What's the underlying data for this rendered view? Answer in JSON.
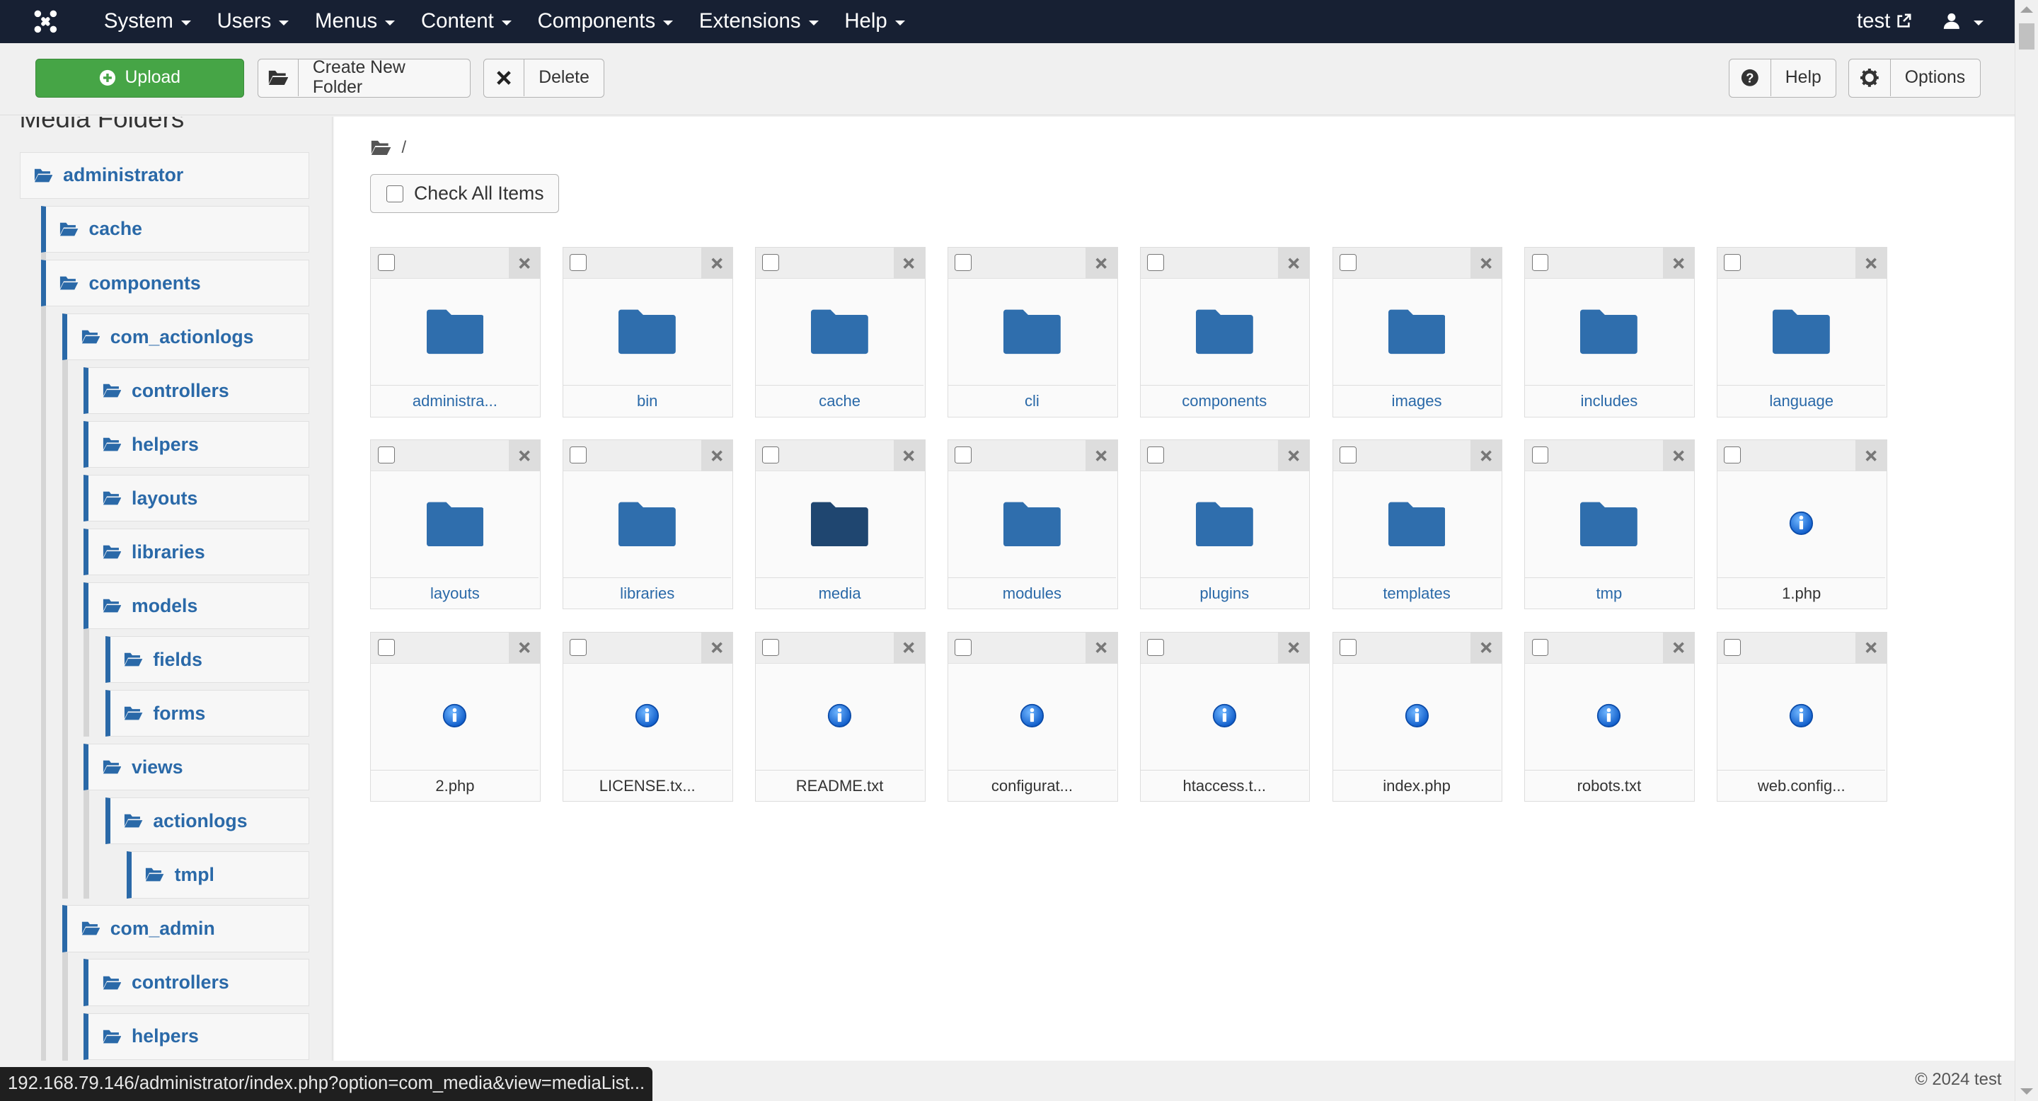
{
  "navbar": {
    "items": [
      "System",
      "Users",
      "Menus",
      "Content",
      "Components",
      "Extensions",
      "Help"
    ],
    "user_link": "test"
  },
  "toolbar": {
    "upload": "Upload",
    "create_folder": "Create New Folder",
    "delete": "Delete",
    "help": "Help",
    "options": "Options"
  },
  "sidebar": {
    "title": "Media Folders",
    "tree": [
      {
        "label": "administrator",
        "level": 0
      },
      {
        "label": "cache",
        "level": 1
      },
      {
        "label": "components",
        "level": 1
      },
      {
        "label": "com_actionlogs",
        "level": 2
      },
      {
        "label": "controllers",
        "level": 3
      },
      {
        "label": "helpers",
        "level": 3
      },
      {
        "label": "layouts",
        "level": 3
      },
      {
        "label": "libraries",
        "level": 3
      },
      {
        "label": "models",
        "level": 3
      },
      {
        "label": "fields",
        "level": 4
      },
      {
        "label": "forms",
        "level": 4
      },
      {
        "label": "views",
        "level": 3
      },
      {
        "label": "actionlogs",
        "level": 4
      },
      {
        "label": "tmpl",
        "level": 5
      },
      {
        "label": "com_admin",
        "level": 2
      },
      {
        "label": "controllers",
        "level": 3
      },
      {
        "label": "helpers",
        "level": 3
      }
    ]
  },
  "main": {
    "breadcrumb_sep": "/",
    "check_all": "Check All Items",
    "items": [
      {
        "name": "administra...",
        "type": "folder"
      },
      {
        "name": "bin",
        "type": "folder"
      },
      {
        "name": "cache",
        "type": "folder"
      },
      {
        "name": "cli",
        "type": "folder"
      },
      {
        "name": "components",
        "type": "folder"
      },
      {
        "name": "images",
        "type": "folder"
      },
      {
        "name": "includes",
        "type": "folder"
      },
      {
        "name": "language",
        "type": "folder"
      },
      {
        "name": "layouts",
        "type": "folder"
      },
      {
        "name": "libraries",
        "type": "folder"
      },
      {
        "name": "media",
        "type": "folder",
        "highlight": true
      },
      {
        "name": "modules",
        "type": "folder"
      },
      {
        "name": "plugins",
        "type": "folder"
      },
      {
        "name": "templates",
        "type": "folder"
      },
      {
        "name": "tmp",
        "type": "folder"
      },
      {
        "name": "1.php",
        "type": "file"
      },
      {
        "name": "2.php",
        "type": "file"
      },
      {
        "name": "LICENSE.tx...",
        "type": "file"
      },
      {
        "name": "README.txt",
        "type": "file"
      },
      {
        "name": "configurat...",
        "type": "file"
      },
      {
        "name": "htaccess.t...",
        "type": "file"
      },
      {
        "name": "index.php",
        "type": "file"
      },
      {
        "name": "robots.txt",
        "type": "file"
      },
      {
        "name": "web.config...",
        "type": "file"
      }
    ]
  },
  "status_url": "192.168.79.146/administrator/index.php?option=com_media&view=mediaList...",
  "footer": "© 2024 test",
  "colors": {
    "navbar": "#172033",
    "link": "#2a69a8",
    "upload": "#46a546",
    "folder": "#2f6ead",
    "folder_active": "#1f4670"
  }
}
